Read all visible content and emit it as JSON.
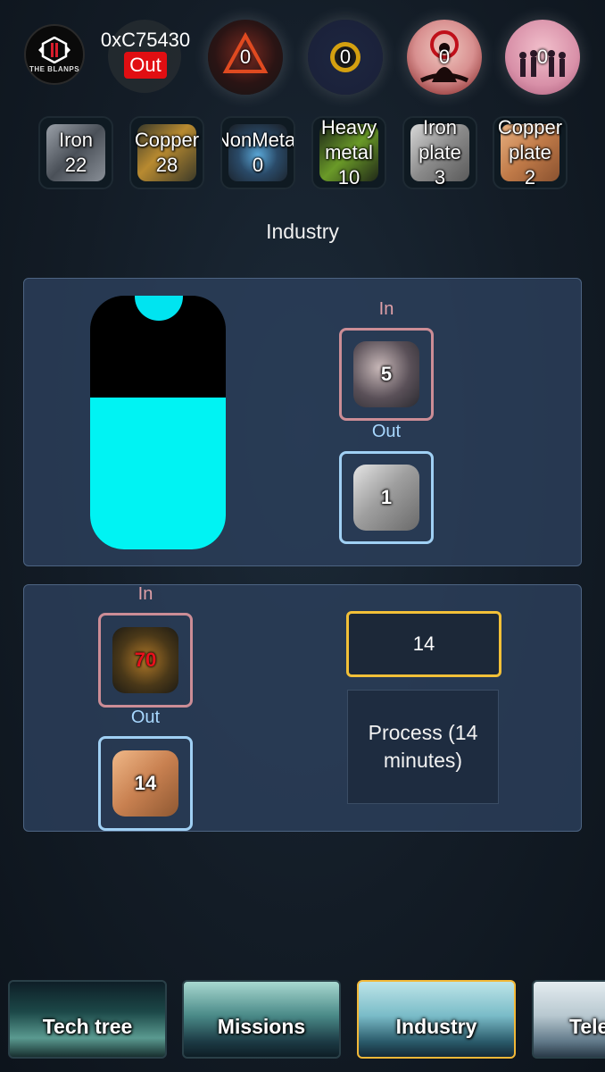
{
  "header": {
    "logo_text": "THE BLANPS",
    "wallet_address": "0xC75430",
    "logout_label": "Out",
    "factions": [
      {
        "id": "triangle",
        "count": "0",
        "colors": [
          "#4a2020",
          "#1a1a1a"
        ]
      },
      {
        "id": "coin",
        "count": "0",
        "colors": [
          "#1d2640",
          "#c09010"
        ]
      },
      {
        "id": "monk",
        "count": "0",
        "colors": [
          "#e8b0b0",
          "#200808"
        ]
      },
      {
        "id": "crowd",
        "count": "0",
        "colors": [
          "#e2a2b8",
          "#1c1020"
        ]
      }
    ]
  },
  "resources": [
    {
      "name": "Iron",
      "amount": "22"
    },
    {
      "name": "Copper",
      "amount": "28"
    },
    {
      "name": "NonMetal",
      "amount": "0"
    },
    {
      "name_line1": "Heavy",
      "name_line2": "metal",
      "amount": "10"
    },
    {
      "name_line1": "Iron",
      "name_line2": "plate",
      "amount": "3"
    },
    {
      "name_line1": "Copper",
      "name_line2": "plate",
      "amount": "2"
    }
  ],
  "section_title": "Industry",
  "iron_recipe": {
    "in_label": "In",
    "out_label": "Out",
    "input_amount": "5",
    "output_amount": "1",
    "progress_fraction": 0.6
  },
  "copper_recipe": {
    "in_label": "In",
    "out_label": "Out",
    "input_amount": "70",
    "output_amount": "14",
    "quantity_value": "14",
    "process_label": "Process (14 minutes)"
  },
  "nav": [
    {
      "label": "Tech tree",
      "active": false
    },
    {
      "label": "Missions",
      "active": false
    },
    {
      "label": "Industry",
      "active": true
    },
    {
      "label": "Tele",
      "active": false
    }
  ]
}
